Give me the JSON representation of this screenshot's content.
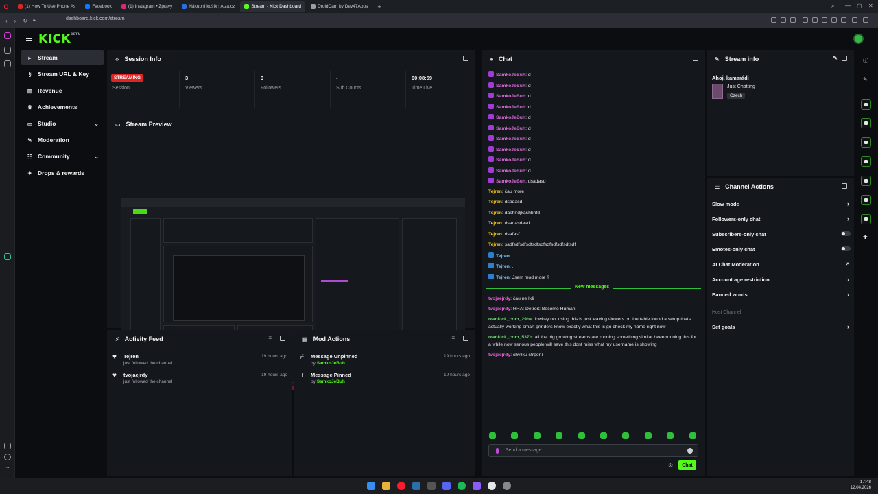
{
  "browser": {
    "tabs": [
      {
        "label": "(1) How To Use Phone As",
        "color": "#e02424"
      },
      {
        "label": "Facebook",
        "color": "#1877f2"
      },
      {
        "label": "(1) Instagram • Zprávy",
        "color": "#d62976"
      },
      {
        "label": "Nákupní košík | Alza.cz",
        "color": "#2a6fdb"
      },
      {
        "label": "Stream - Kick Dashboard",
        "color": "#53fc18"
      },
      {
        "label": "DroidCam by Dev47Apps",
        "color": "#9aa0a6"
      }
    ],
    "new_tab": "+",
    "url": "dashboard.kick.com/stream"
  },
  "app": {
    "logo": "KICK",
    "logo_sup": "BETA",
    "accent": "#53fc18"
  },
  "nav": {
    "items": [
      {
        "label": "Stream",
        "icon": "play-icon"
      },
      {
        "label": "Stream URL & Key",
        "icon": "key-icon"
      },
      {
        "label": "Revenue",
        "icon": "chart-icon"
      },
      {
        "label": "Achievements",
        "icon": "trophy-icon"
      },
      {
        "label": "Studio",
        "icon": "studio-icon",
        "chevron": "⌄"
      },
      {
        "label": "Moderation",
        "icon": "wrench-icon"
      },
      {
        "label": "Community",
        "icon": "community-icon",
        "chevron": "⌄"
      },
      {
        "label": "Drops & rewards",
        "icon": "gift-icon"
      }
    ]
  },
  "session": {
    "title": "Session Info",
    "badge": "STREAMING",
    "badge_label": "Session",
    "stats": [
      {
        "value": "3",
        "label": "Viewers"
      },
      {
        "value": "3",
        "label": "Followers"
      },
      {
        "value": "-",
        "label": "Sub Counts"
      },
      {
        "value": "00:08:59",
        "label": "Time Live"
      }
    ]
  },
  "preview": {
    "title": "Stream Preview"
  },
  "activity": {
    "title": "Activity Feed",
    "items": [
      {
        "user": "Tejren",
        "text": "just followed the channel",
        "time": "19 hours ago"
      },
      {
        "user": "tvojaejrdy",
        "text": "just followed the channel",
        "time": "19 hours ago"
      }
    ]
  },
  "mod_actions": {
    "title": "Mod Actions",
    "items": [
      {
        "action": "Message Unpinned",
        "by": "by",
        "mod": "SamkoJeBuh",
        "time": "19 hours ago"
      },
      {
        "action": "Message Pinned",
        "by": "by",
        "mod": "SamkoJeBuh",
        "time": "19 hours ago"
      }
    ]
  },
  "chat": {
    "title": "Chat",
    "messages": [
      {
        "user": "SamkoJeBuh",
        "text": "d",
        "color": "#d36ad6",
        "badge": "#a23bd6"
      },
      {
        "user": "SamkoJeBuh",
        "text": "d",
        "color": "#d36ad6",
        "badge": "#a23bd6"
      },
      {
        "user": "SamkoJeBuh",
        "text": "d",
        "color": "#d36ad6",
        "badge": "#a23bd6"
      },
      {
        "user": "SamkoJeBuh",
        "text": "d",
        "color": "#d36ad6",
        "badge": "#a23bd6"
      },
      {
        "user": "SamkoJeBuh",
        "text": "d",
        "color": "#d36ad6",
        "badge": "#a23bd6"
      },
      {
        "user": "SamkoJeBuh",
        "text": "d",
        "color": "#d36ad6",
        "badge": "#a23bd6"
      },
      {
        "user": "SamkoJeBuh",
        "text": "d",
        "color": "#d36ad6",
        "badge": "#a23bd6"
      },
      {
        "user": "SamkoJeBuh",
        "text": "d",
        "color": "#d36ad6",
        "badge": "#a23bd6"
      },
      {
        "user": "SamkoJeBuh",
        "text": "d",
        "color": "#d36ad6",
        "badge": "#a23bd6"
      },
      {
        "user": "SamkoJeBuh",
        "text": "d",
        "color": "#d36ad6",
        "badge": "#a23bd6"
      },
      {
        "user": "SamkoJeBuh",
        "text": "dsadasd",
        "color": "#d36ad6",
        "badge": "#a23bd6"
      },
      {
        "user": "Tejren",
        "text": "čau more",
        "color": "#f0c419",
        "badge": ""
      },
      {
        "user": "Tejren",
        "text": "dsadasd",
        "color": "#f0c419",
        "badge": ""
      },
      {
        "user": "Tejren",
        "text": "dashndjkashbnfd",
        "color": "#f0c419",
        "badge": ""
      },
      {
        "user": "Tejren",
        "text": "dsadasdasd",
        "color": "#f0c419",
        "badge": ""
      },
      {
        "user": "Tejren",
        "text": "dsafasf",
        "color": "#f0c419",
        "badge": ""
      },
      {
        "user": "Tejren",
        "text": "sadfsdfsdfsdfsdfsdfsdfsdfsdfsdfsdf",
        "color": "#f0c419",
        "badge": ""
      },
      {
        "user": "Tejren",
        "text": ".",
        "color": "#7fc8ff",
        "badge": "#2c7fc9"
      },
      {
        "user": "Tejren",
        "text": ".",
        "color": "#7fc8ff",
        "badge": "#2c7fc9"
      },
      {
        "user": "Tejren",
        "text": "Jsem mod more ?",
        "color": "#7fc8ff",
        "badge": "#2c7fc9"
      }
    ],
    "divider": "New messages",
    "new_messages": [
      {
        "user": "tvojaejrdy",
        "text": "čau ne lidi",
        "color": "#e35fd0"
      },
      {
        "user": "tvojaejrdy",
        "text": "HRA: Detroit: Become Human",
        "color": "#e35fd0"
      },
      {
        "user": "ownkick_com_29be",
        "text": "lowkey not using this is just leaving viewers on the table found a setup thats actually working smart grinders know exactly what this is go check my name right now",
        "color": "#6ad66a"
      },
      {
        "user": "ownkick_com_537b",
        "text": "all the big growing streams are running something similar been running this for a while now serious people will save this dont miss what my username is showing",
        "color": "#6ad66a"
      },
      {
        "user": "tvojaejrdy",
        "text": "chvilku strpení",
        "color": "#e35fd0"
      }
    ],
    "placeholder": "Send a message",
    "send": "Chat"
  },
  "stream_info": {
    "title": "Stream info",
    "stream_title": "Ahoj, kamarádi",
    "category": "Just Chatting",
    "language": "Czech"
  },
  "channel_actions": {
    "title": "Channel Actions",
    "items": [
      {
        "label": "Slow mode",
        "ctrl": "chevron"
      },
      {
        "label": "Followers-only chat",
        "ctrl": "chevron"
      },
      {
        "label": "Subscribers-only chat",
        "ctrl": "toggle"
      },
      {
        "label": "Emotes-only chat",
        "ctrl": "toggle"
      },
      {
        "label": "AI Chat Moderation",
        "ctrl": "external"
      },
      {
        "label": "Account age restriction",
        "ctrl": "chevron"
      },
      {
        "label": "Banned words",
        "ctrl": "chevron"
      }
    ],
    "host_label": "Host Channel",
    "set_goals": "Set goals"
  },
  "taskbar": {
    "time": "17:48",
    "date": "12.04.2026"
  }
}
